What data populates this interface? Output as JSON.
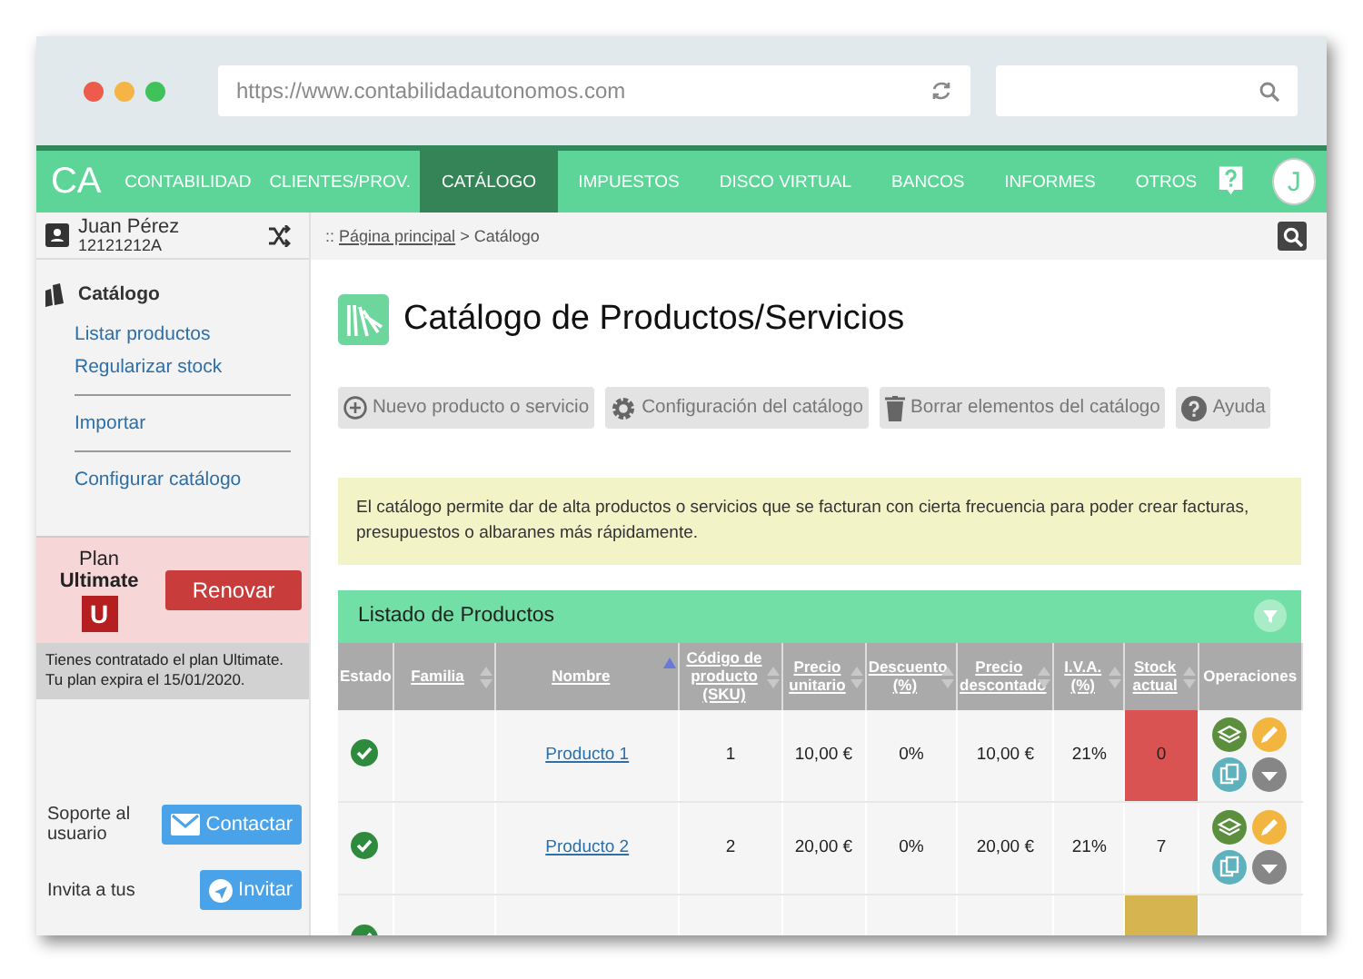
{
  "browser": {
    "url": "https://www.contabilidadautonomos.com"
  },
  "nav": {
    "logo": "CA",
    "avatar": "J",
    "items": [
      {
        "label": "CONTABILIDAD",
        "selected": false
      },
      {
        "label": "CLIENTES/PROV.",
        "selected": false
      },
      {
        "label": "CATÁLOGO",
        "selected": true
      },
      {
        "label": "IMPUESTOS",
        "selected": false
      },
      {
        "label": "DISCO VIRTUAL",
        "selected": false
      },
      {
        "label": "BANCOS",
        "selected": false
      },
      {
        "label": "INFORMES",
        "selected": false
      },
      {
        "label": "OTROS",
        "selected": false
      }
    ]
  },
  "user": {
    "name": "Juan Pérez",
    "id": "12121212A"
  },
  "breadcrumb": {
    "prefix": "::",
    "link": "Página principal",
    "separator": ">",
    "current": "Catálogo"
  },
  "sidebar": {
    "section": "Catálogo",
    "groups": [
      [
        "Listar productos",
        "Regularizar stock"
      ],
      [
        "Importar"
      ],
      [
        "Configurar catálogo"
      ]
    ]
  },
  "plan": {
    "label": "Plan",
    "name": "Ultimate",
    "badge": "U",
    "button": "Renovar",
    "note": "Tienes contratado el plan Ultimate.\nTu plan expira el 15/01/2020."
  },
  "support": [
    {
      "kind": "mail",
      "label": "Soporte al usuario",
      "button": "Contactar"
    },
    {
      "kind": "share",
      "label": "Invita a tus",
      "button": "Invitar"
    }
  ],
  "page": {
    "title": "Catálogo de Productos/Servicios",
    "toolbar": [
      {
        "kind": "add",
        "label": "Nuevo producto o servicio"
      },
      {
        "kind": "gear",
        "label": "Configuración del catálogo"
      },
      {
        "kind": "trash",
        "label": "Borrar elementos del catálogo"
      },
      {
        "kind": "help",
        "label": "Ayuda"
      }
    ],
    "info": "El catálogo permite dar de alta productos o servicios que se facturan con cierta frecuencia para poder crear facturas, presupuestos o albaranes más rápidamente.",
    "table": {
      "title": "Listado de Productos",
      "columns": [
        {
          "label": "Estado",
          "sortable": false,
          "sorted": false
        },
        {
          "label": "Familia",
          "sortable": true,
          "sorted": false
        },
        {
          "label": "Nombre",
          "sortable": true,
          "sorted": true
        },
        {
          "label": "Código de producto (SKU)",
          "sortable": true,
          "sorted": false
        },
        {
          "label": "Precio unitario",
          "sortable": true,
          "sorted": false
        },
        {
          "label": "Descuento (%)",
          "sortable": true,
          "sorted": false
        },
        {
          "label": "Precio descontado",
          "sortable": true,
          "sorted": false
        },
        {
          "label": "I.V.A. (%)",
          "sortable": true,
          "sorted": false
        },
        {
          "label": "Stock actual",
          "sortable": true,
          "sorted": false
        },
        {
          "label": "Operaciones",
          "sortable": false,
          "sorted": false
        }
      ],
      "rows": [
        {
          "active": true,
          "name": "Producto 1",
          "sku": "1",
          "price": "10,00 €",
          "discount": "0%",
          "discounted": "10,00 €",
          "vat": "21%",
          "stock": "0",
          "color": "#d95353"
        },
        {
          "active": true,
          "name": "Producto 2",
          "sku": "2",
          "price": "20,00 €",
          "discount": "0%",
          "discounted": "20,00 €",
          "vat": "21%",
          "stock": "7"
        },
        {
          "active": true,
          "color": "#d6b44f"
        }
      ]
    }
  }
}
